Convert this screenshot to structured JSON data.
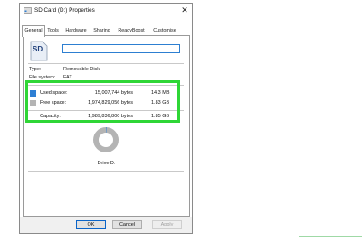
{
  "window": {
    "title": "SD Card (D:) Properties",
    "close_glyph": "✕"
  },
  "tabs": [
    {
      "label": "General",
      "active": true
    },
    {
      "label": "Tools",
      "active": false
    },
    {
      "label": "Hardware",
      "active": false
    },
    {
      "label": "Sharing",
      "active": false
    },
    {
      "label": "ReadyBoost",
      "active": false
    },
    {
      "label": "Customise",
      "active": false
    }
  ],
  "general": {
    "icon_text": "SD",
    "name_value": "",
    "type_label": "Type:",
    "type_value": "Removable Disk",
    "fs_label": "File system:",
    "fs_value": "FAT",
    "used": {
      "label": "Used space:",
      "bytes": "15,007,744 bytes",
      "size": "14.3 MB",
      "color": "#2e7fd4"
    },
    "free": {
      "label": "Free space:",
      "bytes": "1,974,829,056 bytes",
      "size": "1.83 GB",
      "color": "#b4b4b4"
    },
    "capacity": {
      "label": "Capacity:",
      "bytes": "1,989,836,800 bytes",
      "size": "1.85 GB"
    },
    "drive_label": "Drive D:",
    "used_fraction": 0.0075
  },
  "buttons": {
    "ok": "OK",
    "cancel": "Cancel",
    "apply": "Apply"
  },
  "colors": {
    "highlight": "#2fd636",
    "accent": "#2d7fd1"
  }
}
